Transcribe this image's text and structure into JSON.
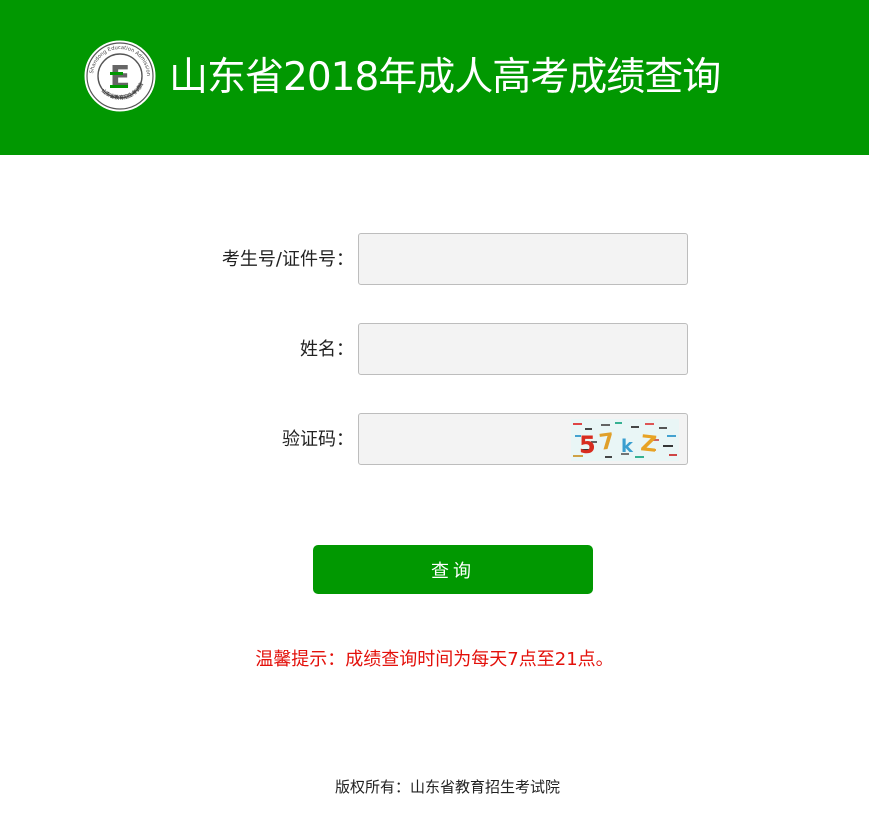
{
  "header": {
    "title": "山东省2018年成人高考成绩查询",
    "background_color": "#019801",
    "logo": {
      "letter": "E",
      "ring_text": "Shandong Education Admission & Examination",
      "bottom_text": "山东省教育招生考试院"
    }
  },
  "form": {
    "candidate_id": {
      "label": "考生号/证件号：",
      "value": "",
      "placeholder": ""
    },
    "name": {
      "label": "姓名：",
      "value": "",
      "placeholder": ""
    },
    "captcha": {
      "label": "验证码：",
      "value": "",
      "placeholder": "",
      "image_text": "57kZ"
    },
    "submit_label": "查询"
  },
  "notice": {
    "text": "温馨提示：成绩查询时间为每天7点至21点。",
    "color": "#e3110b"
  },
  "footer": {
    "copyright": "版权所有：山东省教育招生考试院"
  }
}
